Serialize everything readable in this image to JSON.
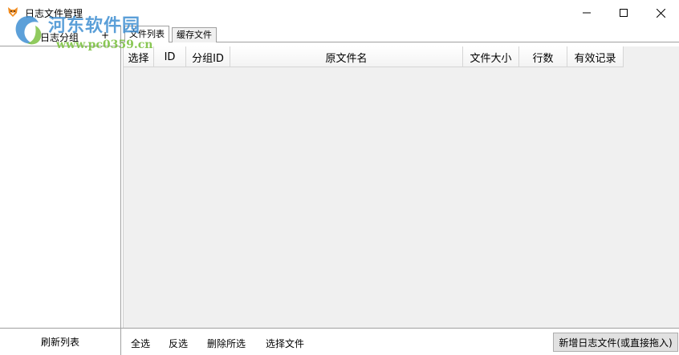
{
  "window": {
    "title": "日志文件管理",
    "minimize_glyph": "—",
    "maximize_glyph": "☐",
    "close_glyph": "✕"
  },
  "watermark": {
    "title": "河东软件园",
    "url": "www.pc0359.cn"
  },
  "left_panel": {
    "header_label": "日志分组",
    "add_glyph": "+",
    "refresh_label": "刷新列表"
  },
  "tabs": [
    {
      "label": "文件列表",
      "active": true
    },
    {
      "label": "缓存文件",
      "active": false
    }
  ],
  "table": {
    "columns": [
      "选择",
      "ID",
      "分组ID",
      "原文件名",
      "文件大小",
      "行数",
      "有效记录"
    ],
    "rows": []
  },
  "bottom_bar": {
    "select_all": "全选",
    "invert_selection": "反选",
    "delete_selected": "删除所选",
    "select_file": "选择文件",
    "add_log_file": "新增日志文件(或直接拖入)"
  },
  "colors": {
    "grid_background": "#f0f0f0",
    "border": "#a0a0a0",
    "button_face": "#e1e1e1",
    "watermark_blue": "#3f8fd2",
    "watermark_green": "#7dc142"
  },
  "icons": {
    "app": "fox-icon",
    "logo": "pc0359-logo-icon"
  }
}
